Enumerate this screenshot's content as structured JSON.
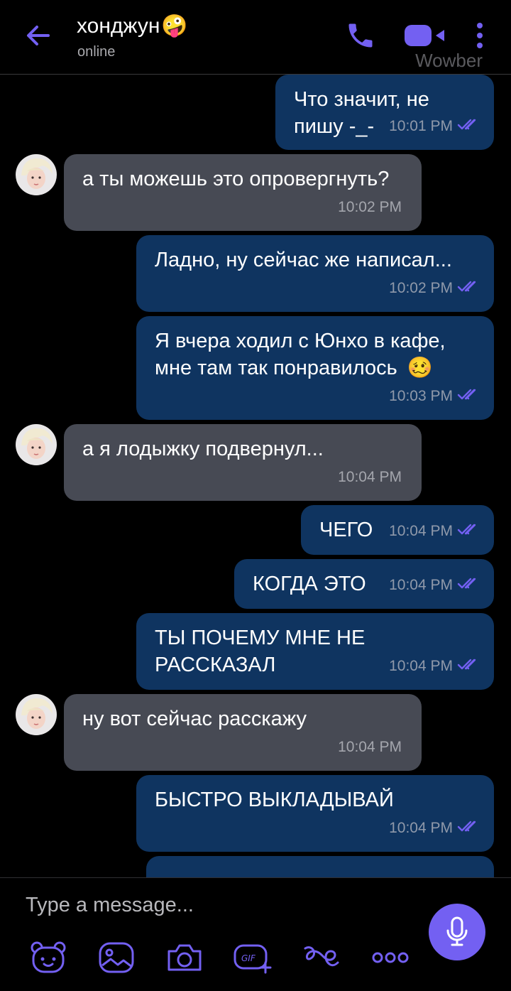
{
  "header": {
    "title": "хонджун",
    "title_emoji": "🤪",
    "status": "online",
    "watermark": "Wowber"
  },
  "messages": [
    {
      "dir": "out",
      "text": "Что значит, не пишу -_-",
      "time": "10:01 PM"
    },
    {
      "dir": "in",
      "text": "а ты можешь это опровергнуть?",
      "time": "10:02 PM"
    },
    {
      "dir": "out",
      "text": "Ладно, ну сейчас же написал...",
      "time": "10:02 PM"
    },
    {
      "dir": "out",
      "text": "Я вчера ходил с Юнхо в кафе, мне там так понравилось",
      "emoji": "🥴",
      "time": "10:03 PM"
    },
    {
      "dir": "in",
      "text": "а я лодыжку подвернул...",
      "time": "10:04 PM"
    },
    {
      "dir": "out",
      "text": "ЧЕГО",
      "time": "10:04 PM"
    },
    {
      "dir": "out",
      "text": "КОГДА ЭТО",
      "time": "10:04 PM"
    },
    {
      "dir": "out",
      "text": "ТЫ ПОЧЕМУ МНЕ НЕ РАССКАЗАЛ",
      "time": "10:04 PM"
    },
    {
      "dir": "in",
      "text": "ну вот сейчас расскажу",
      "time": "10:04 PM"
    },
    {
      "dir": "out",
      "text": "БЫСТРО ВЫКЛАДЫВАЙ",
      "time": "10:04 PM"
    }
  ],
  "composer": {
    "placeholder": "Type a message...",
    "gif_label": "GIF"
  },
  "colors": {
    "accent": "#7360f2",
    "outgoing_bubble": "#0f3460",
    "incoming_bubble": "#474a54"
  }
}
